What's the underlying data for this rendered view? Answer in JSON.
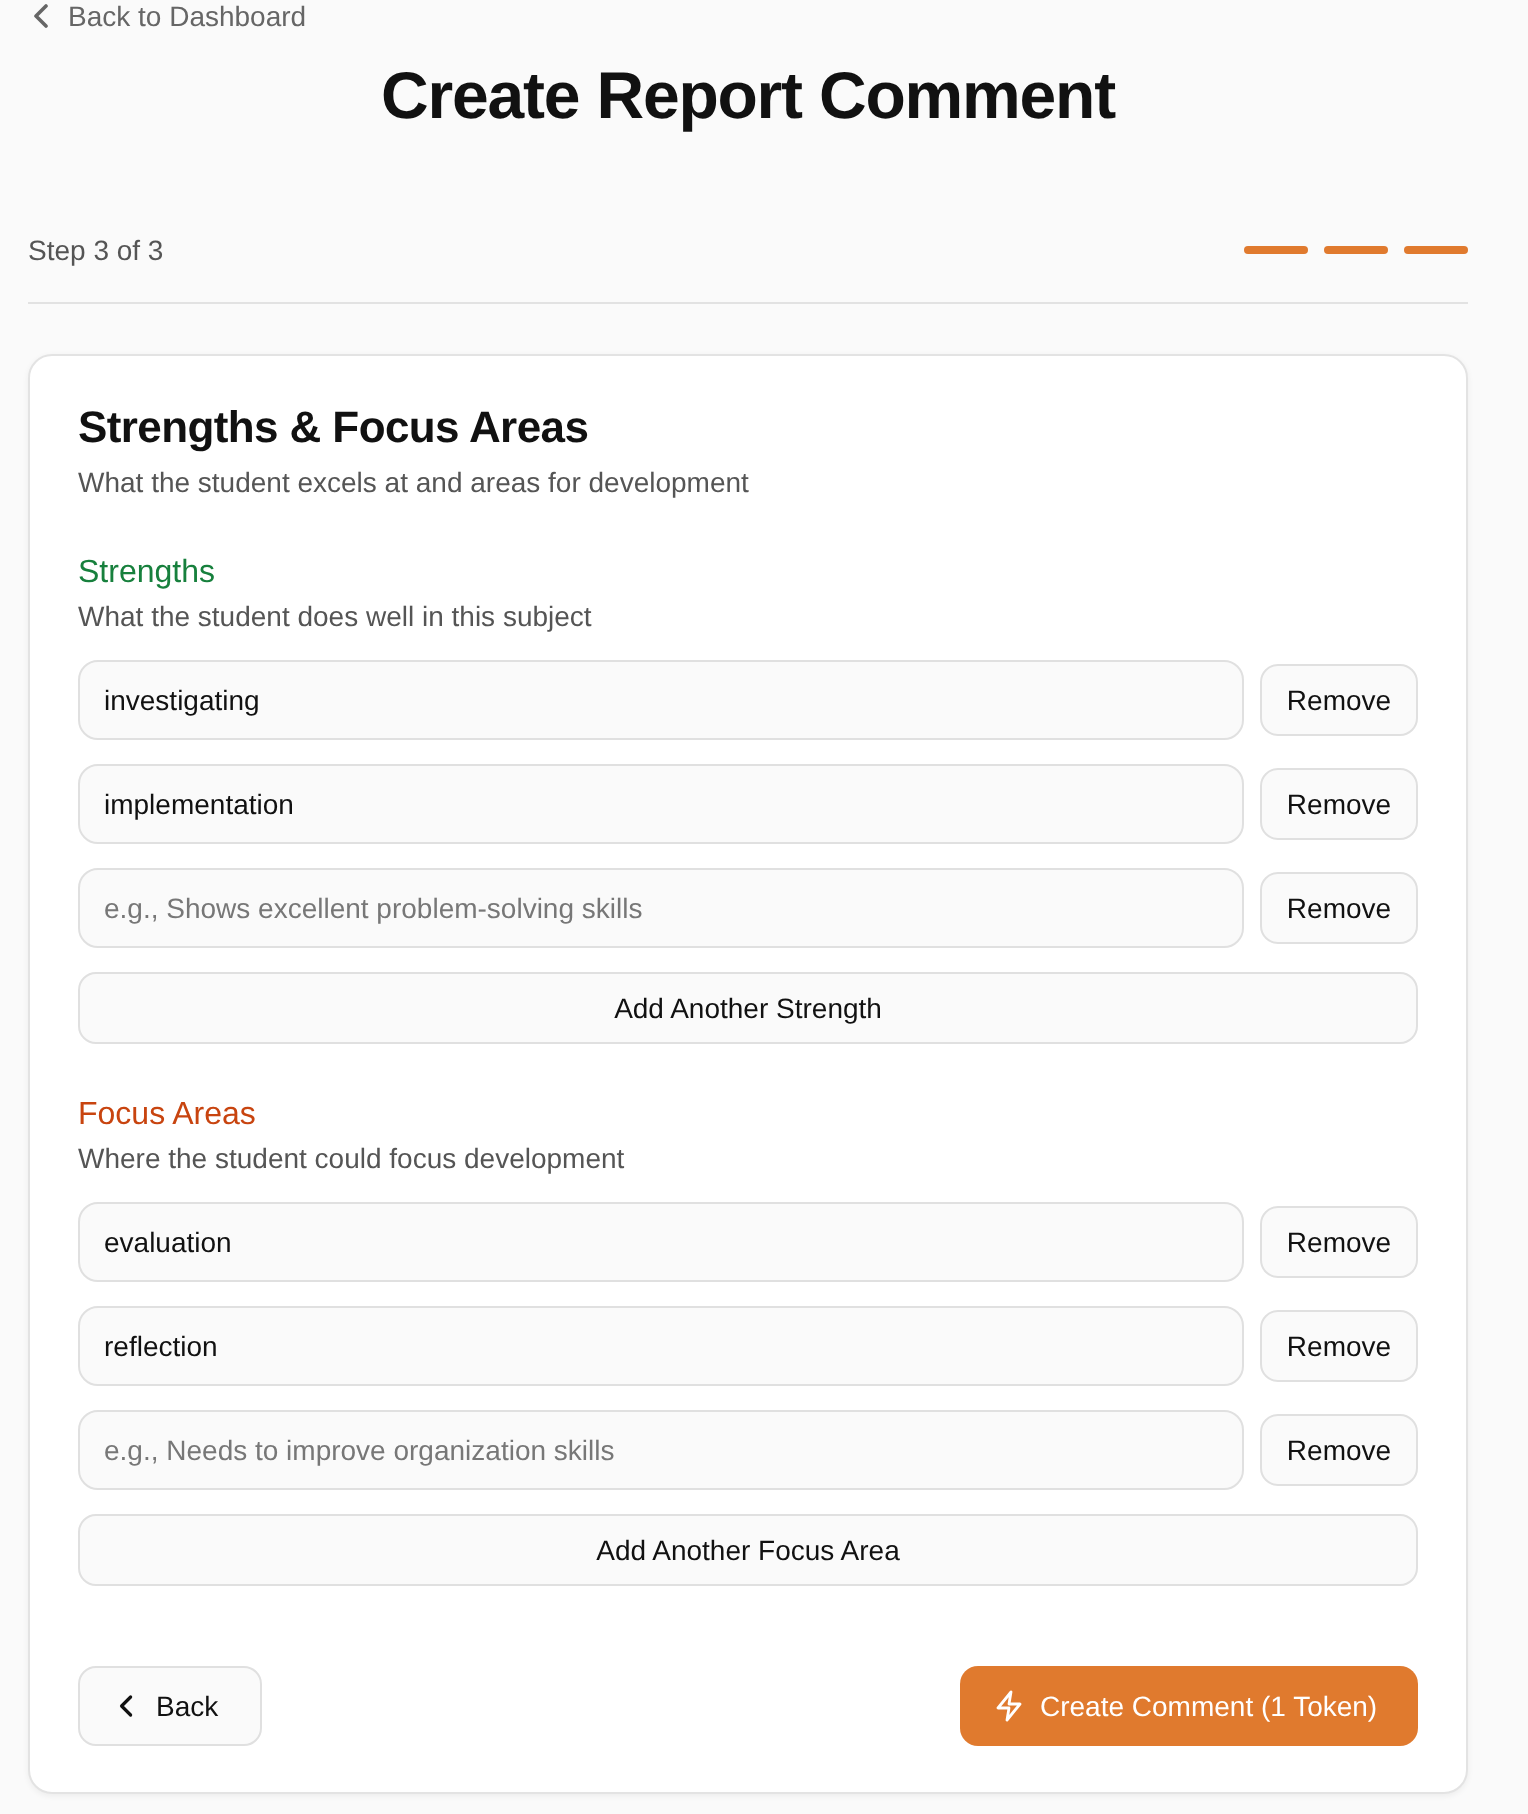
{
  "back_link": {
    "label": "Back to Dashboard"
  },
  "title": "Create Report Comment",
  "stepper": {
    "label": "Step 3 of 3",
    "steps": [
      {
        "completed": true
      },
      {
        "completed": true
      },
      {
        "completed": true
      }
    ]
  },
  "card": {
    "title": "Strengths & Focus Areas",
    "subtitle": "What the student excels at and areas for development",
    "sections": [
      {
        "title": "Strengths",
        "color": "#17803d",
        "subtitle": "What the student does well in this subject",
        "entries": [
          {
            "value": "investigating",
            "remove": "Remove"
          },
          {
            "value": "implementation",
            "remove": "Remove"
          },
          {
            "placeholder": "e.g., Shows excellent problem-solving skills",
            "remove": "Remove"
          }
        ],
        "add_button": "Add Another Strength"
      },
      {
        "title": "Focus Areas",
        "color": "#c8440f",
        "subtitle": "Where the student could focus development",
        "entries": [
          {
            "value": "evaluation",
            "remove": "Remove"
          },
          {
            "value": "reflection",
            "remove": "Remove"
          },
          {
            "placeholder": "e.g., Needs to improve organization skills",
            "remove": "Remove"
          }
        ],
        "add_button": "Add Another Focus Area"
      }
    ]
  },
  "footer": {
    "back_button": "Back",
    "submit_button": "Create Comment (1 Token)"
  }
}
